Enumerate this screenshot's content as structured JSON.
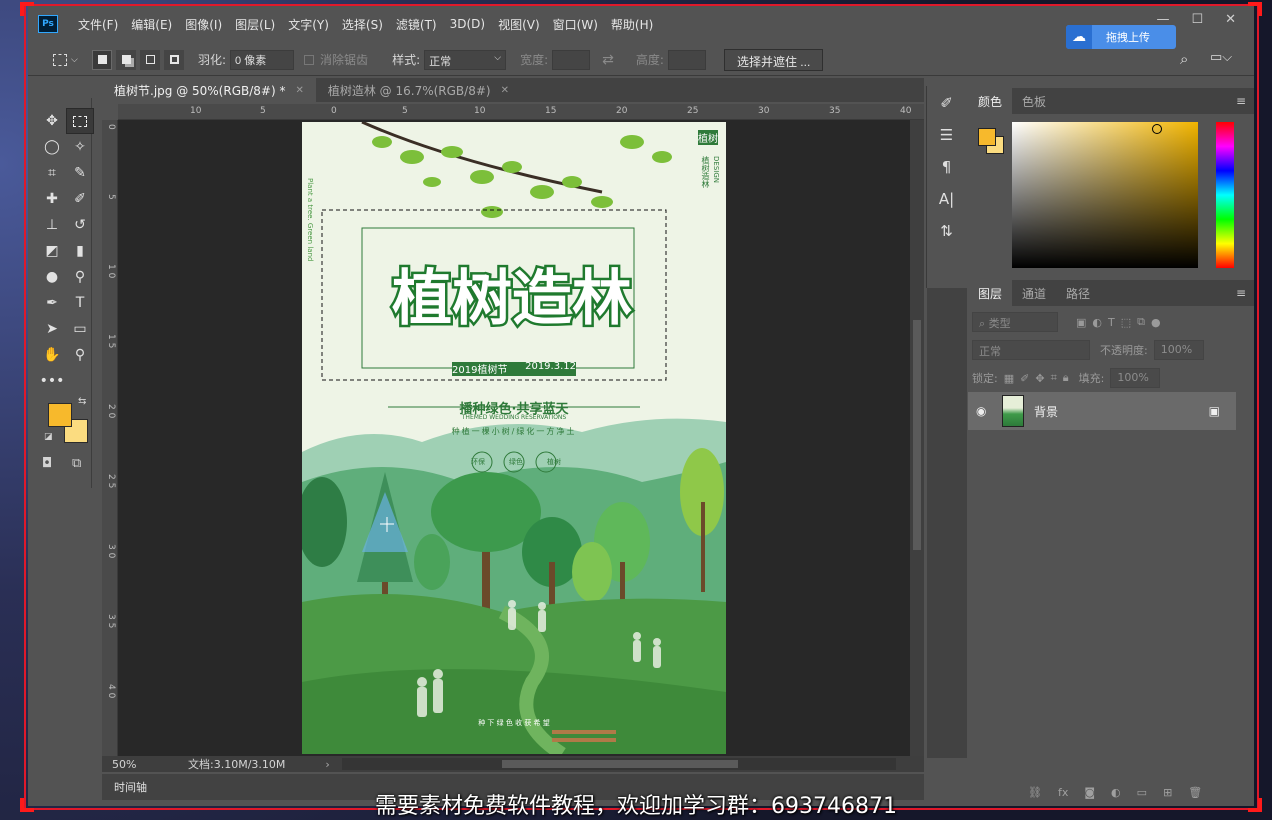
{
  "menu": [
    "文件(F)",
    "编辑(E)",
    "图像(I)",
    "图层(L)",
    "文字(Y)",
    "选择(S)",
    "滤镜(T)",
    "3D(D)",
    "视图(V)",
    "窗口(W)",
    "帮助(H)"
  ],
  "upload_button": "拖拽上传",
  "options": {
    "feather_label": "羽化:",
    "feather_value": "0 像素",
    "antialias_label": "消除锯齿",
    "style_label": "样式:",
    "style_value": "正常",
    "width_label": "宽度:",
    "height_label": "高度:",
    "select_mask_button": "选择并遮住 ..."
  },
  "tabs": [
    {
      "label": "植树节.jpg @ 50%(RGB/8#) *",
      "active": true
    },
    {
      "label": "植树造林 @ 16.7%(RGB/8#)",
      "active": false
    }
  ],
  "ruler_h": [
    "10",
    "5",
    "0",
    "5",
    "10",
    "15",
    "20",
    "25",
    "30",
    "35",
    "40"
  ],
  "ruler_v": [
    "0",
    "5",
    "1 0",
    "1 5",
    "2 0",
    "2 5",
    "3 0",
    "3 5",
    "4 0"
  ],
  "poster": {
    "main_title": "植树造林",
    "date_line_left": "2019植树节",
    "date_line_right": "2019.3.12",
    "slogan": "播种绿色·共享蓝天",
    "slogan_en": "THEMED WEDDING RESERVATIONS",
    "sub_slogan": "种植一棵小树/绿化一方净土",
    "badges": [
      "环保",
      "绿色",
      "植树"
    ],
    "side_en": "Plant a tree. Green land",
    "corner_title": "植树",
    "corner_sub": "植树造林",
    "corner_en": "DESIGN",
    "bottom_text": "种 下 绿 色   收 获 希 望"
  },
  "status": {
    "zoom": "50%",
    "doc_info": "文档:3.10M/3.10M"
  },
  "timeline_label": "时间轴",
  "color_panel": {
    "tabs": [
      "颜色",
      "色板"
    ],
    "foreground": "#f7b92c",
    "background": "#fbdc80"
  },
  "layers_panel": {
    "tabs": [
      "图层",
      "通道",
      "路径"
    ],
    "filter_placeholder": "类型",
    "blend_mode": "正常",
    "opacity_label": "不透明度:",
    "opacity_value": "100%",
    "lock_label": "锁定:",
    "fill_label": "填充:",
    "fill_value": "100%",
    "layers": [
      {
        "name": "背景",
        "locked": true,
        "visible": true
      }
    ]
  },
  "subtitle": "需要素材免费软件教程，欢迎加学习群：693746871"
}
